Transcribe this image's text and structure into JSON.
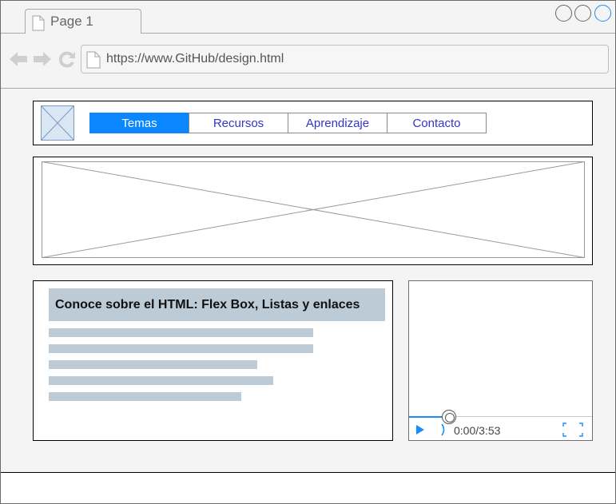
{
  "browser": {
    "tab": {
      "label": "Page 1"
    },
    "address": {
      "url": "https://www.GitHub/design.html"
    }
  },
  "navbar": {
    "items": [
      {
        "label": "Temas",
        "active": true
      },
      {
        "label": "Recursos",
        "active": false
      },
      {
        "label": "Aprendizaje",
        "active": false
      },
      {
        "label": "Contacto",
        "active": false
      }
    ]
  },
  "article": {
    "title": "Conoce sobre el HTML: Flex Box, Listas y enlaces"
  },
  "video": {
    "time": "0:00/3:53",
    "progress": 0.22
  },
  "colors": {
    "accent": "#0a86ff",
    "link": "#3434cc",
    "placeholder_block": "#bccbd6"
  },
  "icons": [
    "document-icon",
    "back-arrow-icon",
    "forward-arrow-icon",
    "reload-icon",
    "image-placeholder-icon",
    "play-icon",
    "volume-icon",
    "fullscreen-icon"
  ]
}
